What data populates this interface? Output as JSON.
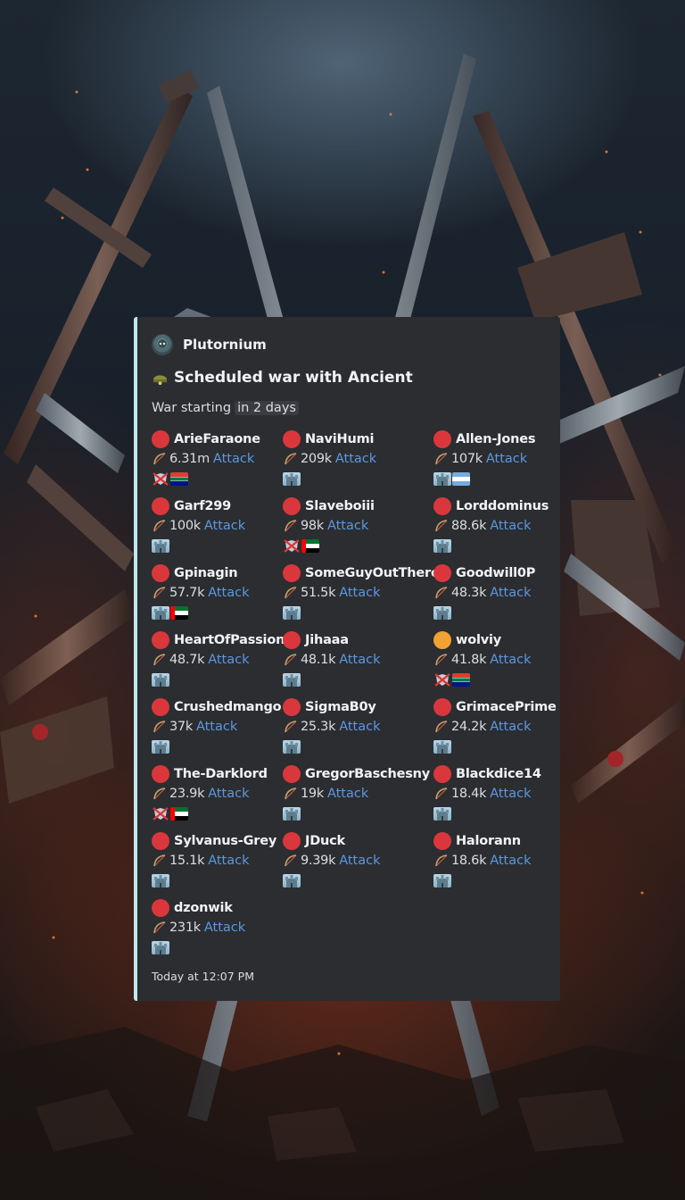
{
  "embed": {
    "author": "Plutornium",
    "title": "Scheduled war with Ancient",
    "subtitle_prefix": "War starting",
    "subtitle_highlight": "in 2 days",
    "footer": "Today at 12:07 PM",
    "accent_color": "#bfe8ec"
  },
  "members": [
    {
      "name": "ArieFaraone",
      "power": "6.31m",
      "attack": "Attack",
      "status": "red",
      "icons": [
        "no-shield-icon",
        "flag-za"
      ]
    },
    {
      "name": "NaviHumi",
      "power": "209k",
      "attack": "Attack",
      "status": "red",
      "icons": [
        "castle-icon"
      ]
    },
    {
      "name": "Allen-Jones",
      "power": "107k",
      "attack": "Attack",
      "status": "red",
      "icons": [
        "castle-icon",
        "flag-ar"
      ]
    },
    {
      "name": "Garf299",
      "power": "100k",
      "attack": "Attack",
      "status": "red",
      "icons": [
        "castle-icon"
      ]
    },
    {
      "name": "Slaveboiii",
      "power": "98k",
      "attack": "Attack",
      "status": "red",
      "icons": [
        "no-shield-icon",
        "flag-ae"
      ]
    },
    {
      "name": "Lorddominus",
      "power": "88.6k",
      "attack": "Attack",
      "status": "red",
      "icons": [
        "castle-icon"
      ]
    },
    {
      "name": "Gpinagin",
      "power": "57.7k",
      "attack": "Attack",
      "status": "red",
      "icons": [
        "castle-icon",
        "flag-ae"
      ]
    },
    {
      "name": "SomeGuyOutThere",
      "power": "51.5k",
      "attack": "Attack",
      "status": "red",
      "icons": [
        "castle-icon"
      ]
    },
    {
      "name": "Goodwill0P",
      "power": "48.3k",
      "attack": "Attack",
      "status": "red",
      "icons": [
        "castle-icon"
      ]
    },
    {
      "name": "HeartOfPassion",
      "power": "48.7k",
      "attack": "Attack",
      "status": "red",
      "icons": [
        "castle-icon"
      ]
    },
    {
      "name": "Jihaaa",
      "power": "48.1k",
      "attack": "Attack",
      "status": "red",
      "icons": [
        "castle-icon"
      ]
    },
    {
      "name": "wolviy",
      "power": "41.8k",
      "attack": "Attack",
      "status": "orange",
      "icons": [
        "no-shield-icon",
        "flag-za"
      ]
    },
    {
      "name": "Crushedmango",
      "power": "37k",
      "attack": "Attack",
      "status": "red",
      "icons": [
        "castle-icon"
      ]
    },
    {
      "name": "SigmaB0y",
      "power": "25.3k",
      "attack": "Attack",
      "status": "red",
      "icons": [
        "castle-icon"
      ]
    },
    {
      "name": "GrimacePrime",
      "power": "24.2k",
      "attack": "Attack",
      "status": "red",
      "icons": [
        "castle-icon"
      ]
    },
    {
      "name": "The-Darklord",
      "power": "23.9k",
      "attack": "Attack",
      "status": "red",
      "icons": [
        "no-shield-icon",
        "flag-ae"
      ]
    },
    {
      "name": "GregorBaschesny",
      "power": "19k",
      "attack": "Attack",
      "status": "red",
      "icons": [
        "castle-icon"
      ]
    },
    {
      "name": "Blackdice14",
      "power": "18.4k",
      "attack": "Attack",
      "status": "red",
      "icons": [
        "castle-icon"
      ]
    },
    {
      "name": "Sylvanus-Grey",
      "power": "15.1k",
      "attack": "Attack",
      "status": "red",
      "icons": [
        "castle-icon"
      ]
    },
    {
      "name": "JDuck",
      "power": "9.39k",
      "attack": "Attack",
      "status": "red",
      "icons": [
        "castle-icon"
      ]
    },
    {
      "name": "Halorann",
      "power": "18.6k",
      "attack": "Attack",
      "status": "red",
      "icons": [
        "castle-icon"
      ]
    },
    {
      "name": "dzonwik",
      "power": "231k",
      "attack": "Attack",
      "status": "red",
      "icons": [
        "castle-icon"
      ]
    }
  ],
  "colors": {
    "red": "#da373c",
    "orange": "#f0a232",
    "link": "#5c98e0"
  }
}
